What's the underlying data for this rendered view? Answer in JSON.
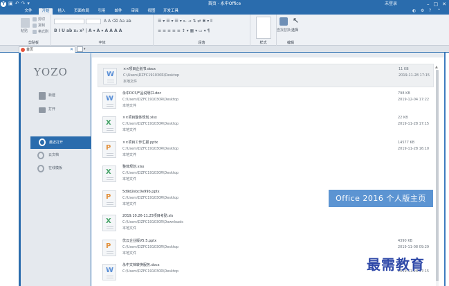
{
  "titlebar": {
    "app_title": "首页 - 永中Office",
    "user": "未登录",
    "logo_letter": "Y"
  },
  "menu": {
    "tabs": [
      {
        "label": "文件"
      },
      {
        "label": "开始"
      },
      {
        "label": "插入"
      },
      {
        "label": "页面布局"
      },
      {
        "label": "引用"
      },
      {
        "label": "邮件"
      },
      {
        "label": "审阅"
      },
      {
        "label": "视图"
      },
      {
        "label": "开发工具"
      }
    ],
    "active_index": 1
  },
  "ribbon": {
    "groups": {
      "clipboard": "剪贴板",
      "font": "字体",
      "paragraph": "段落",
      "style": "样式",
      "edit": "编辑"
    },
    "clipboard_items": [
      "剪切",
      "复制",
      "格式刷"
    ],
    "paste_label": "粘贴",
    "find_replace": "查找替换",
    "select": "选择"
  },
  "tabs": {
    "home_tab": "首页"
  },
  "sidebar": {
    "logo": "YOZO",
    "items": [
      {
        "label": "新建",
        "icon": "new-doc-icon"
      },
      {
        "label": "打开",
        "icon": "folder-icon"
      },
      {
        "label": "最近打开",
        "icon": "clock-icon"
      },
      {
        "label": "云文档",
        "icon": "cloud-icon"
      },
      {
        "label": "在线模板",
        "icon": "template-icon"
      }
    ],
    "active_index": 2
  },
  "files": [
    {
      "type": "W",
      "name": "××项目企划书.docx",
      "path": "C:\\Users\\DZFC191030R\\Desktop",
      "location": "本地文件",
      "size": "11 KB",
      "date": "2019-11-28 17:15"
    },
    {
      "type": "W",
      "name": "永中DCS产品说明书.doc",
      "path": "C:\\Users\\DZFC191030R\\Desktop",
      "location": "本地文件",
      "size": "798 KB",
      "date": "2019-12-04 17:22"
    },
    {
      "type": "X",
      "name": "××项目整体规划.xlsx",
      "path": "C:\\Users\\DZFC191030R\\Desktop",
      "location": "本地文件",
      "size": "22 KB",
      "date": "2019-11-28 17:15"
    },
    {
      "type": "P",
      "name": "××项目工作汇报.pptx",
      "path": "C:\\Users\\DZFC191030R\\Desktop",
      "location": "本地文件",
      "size": "14577 KB",
      "date": "2019-11-28 16:10"
    },
    {
      "type": "X",
      "name": "整体规划.xlsx",
      "path": "C:\\Users\\DZFC191030R\\Desktop",
      "location": "本地文件",
      "size": "",
      "date": ""
    },
    {
      "type": "P",
      "name": "5d9d2ebc0e99b.pptx",
      "path": "C:\\Users\\DZFC191030R\\Desktop",
      "location": "本地文件",
      "size": "",
      "date": ""
    },
    {
      "type": "X",
      "name": "2019.10.26-11.25项目考勤.xls",
      "path": "C:\\Users\\DZFC191030R\\Downloads",
      "location": "本地文件",
      "size": "",
      "date": ""
    },
    {
      "type": "P",
      "name": "优云企业版V5.5.pptx",
      "path": "C:\\Users\\DZFC191030R\\Desktop",
      "location": "本地文件",
      "size": "4390 KB",
      "date": "2019-11-08 09:29"
    },
    {
      "type": "W",
      "name": "永中文档转换服务.docx",
      "path": "C:\\Users\\DZFC191030R\\Desktop",
      "location": "",
      "size": "",
      "date": "2019-11-28 17:15"
    }
  ],
  "banner": "Office 2016 个人版主页",
  "watermark": "最需教育",
  "colors": {
    "accent": "#2a6cad",
    "word": "#5a8fd6",
    "excel": "#45a367",
    "ppt": "#e2903a"
  }
}
